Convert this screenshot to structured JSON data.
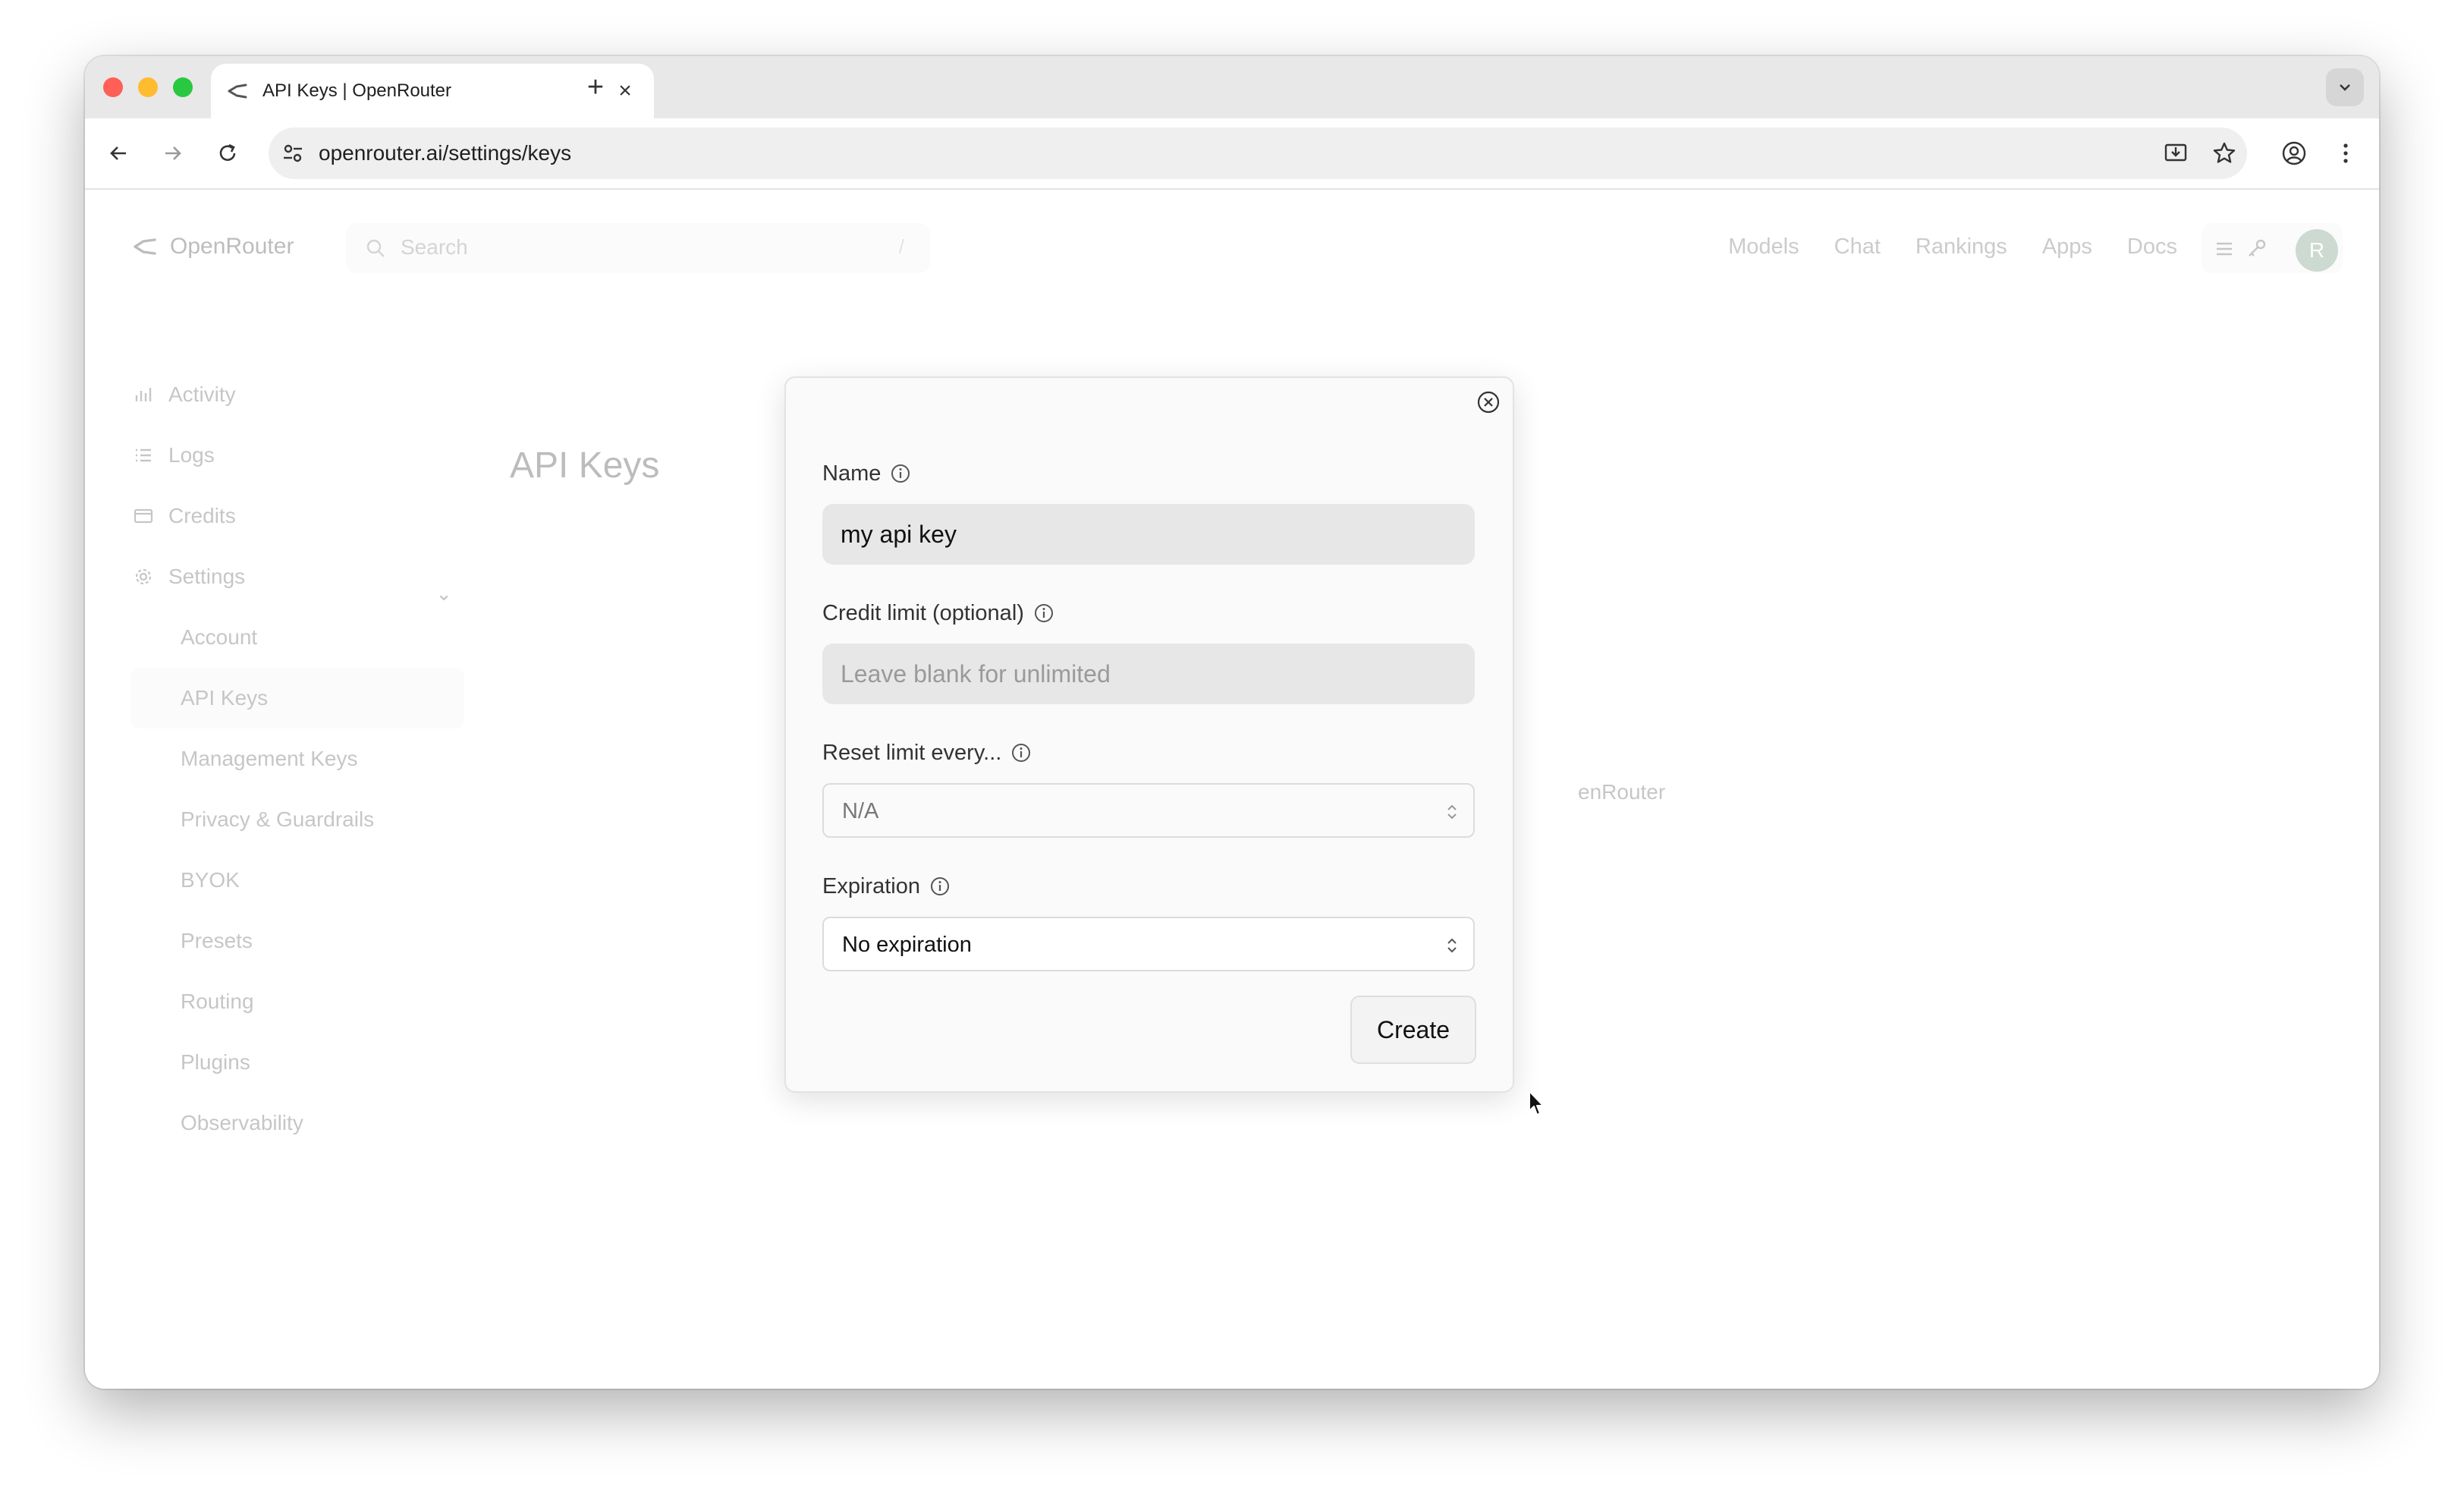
{
  "browser": {
    "tab_title": "API Keys | OpenRouter",
    "url": "openrouter.ai/settings/keys"
  },
  "site": {
    "brand": "OpenRouter",
    "search_placeholder": "Search",
    "search_shortcut": "/",
    "nav": [
      "Models",
      "Chat",
      "Rankings",
      "Apps",
      "Docs"
    ],
    "avatar_initial": "R"
  },
  "sidebar": {
    "items": [
      {
        "label": "Activity",
        "icon": "bar-chart-icon"
      },
      {
        "label": "Logs",
        "icon": "list-icon"
      },
      {
        "label": "Credits",
        "icon": "credit-card-icon"
      },
      {
        "label": "Settings",
        "icon": "gear-icon"
      }
    ],
    "settings_children": [
      "Account",
      "API Keys",
      "Management Keys",
      "Privacy & Guardrails",
      "BYOK",
      "Presets",
      "Routing",
      "Plugins",
      "Observability"
    ],
    "active": "API Keys"
  },
  "page": {
    "title": "API Keys",
    "bg_text": "enRouter"
  },
  "modal": {
    "name_label": "Name",
    "name_value": "my api key",
    "credit_label": "Credit limit (optional)",
    "credit_placeholder": "Leave blank for unlimited",
    "reset_label": "Reset limit every...",
    "reset_value": "N/A",
    "expiration_label": "Expiration",
    "expiration_value": "No expiration",
    "create_label": "Create"
  }
}
